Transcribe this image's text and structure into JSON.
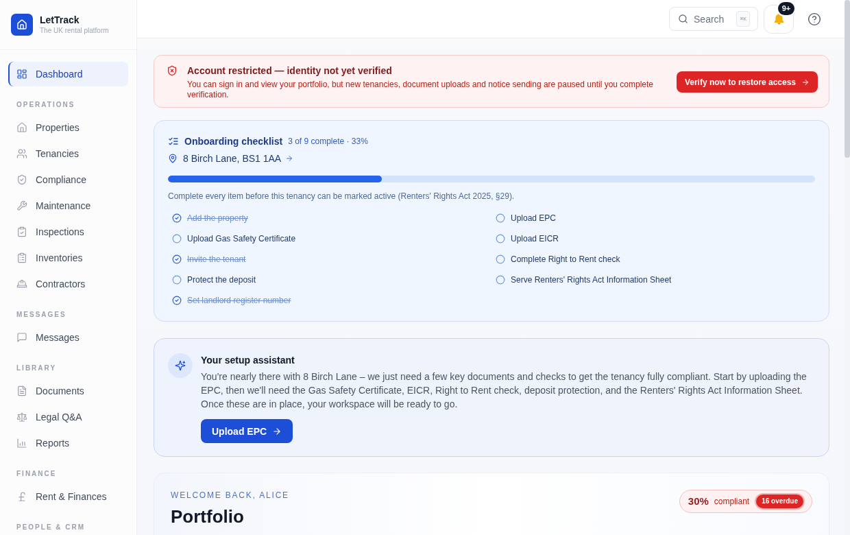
{
  "app": {
    "name": "LetTrack",
    "tagline": "The UK rental platform"
  },
  "sidebar": {
    "sections": [
      {
        "items": [
          {
            "label": "Dashboard",
            "selected": true
          }
        ]
      },
      {
        "heading": "OPERATIONS",
        "items": [
          {
            "label": "Properties",
            "selected": false
          },
          {
            "label": "Tenancies",
            "selected": false
          },
          {
            "label": "Compliance",
            "selected": false
          },
          {
            "label": "Maintenance",
            "selected": false
          },
          {
            "label": "Inspections",
            "selected": false
          },
          {
            "label": "Inventories",
            "selected": false
          },
          {
            "label": "Contractors",
            "selected": false
          }
        ]
      },
      {
        "heading": "MESSAGES",
        "items": [
          {
            "label": "Messages",
            "selected": false
          }
        ]
      },
      {
        "heading": "LIBRARY",
        "items": [
          {
            "label": "Documents",
            "selected": false
          },
          {
            "label": "Legal Q&A",
            "selected": false
          },
          {
            "label": "Reports",
            "selected": false
          }
        ]
      },
      {
        "heading": "FINANCE",
        "items": [
          {
            "label": "Rent & Finances",
            "selected": false
          }
        ]
      },
      {
        "heading": "PEOPLE & CRM"
      }
    ]
  },
  "topbar": {
    "search": {
      "label": "Search",
      "shortcut": "⌘K"
    },
    "notifications": {
      "count": "9+"
    }
  },
  "alert": {
    "title": "Account restricted — identity not yet verified",
    "message": "You can sign in and view your portfolio, but new tenancies, document uploads and notice sending are paused until you complete verification.",
    "action": "Verify now to restore access"
  },
  "checklist": {
    "title": "Onboarding checklist",
    "summary": "3 of 9 complete · 33%",
    "property": "8 Birch Lane, BS1 1AA",
    "progress": {
      "level": 0.33
    },
    "note": "Complete every item before this tenancy can be marked active (Renters' Rights Act 2025, §29).",
    "items": [
      {
        "label": "Add the property",
        "checked": true
      },
      {
        "label": "Upload EPC",
        "checked": false
      },
      {
        "label": "Upload Gas Safety Certificate",
        "checked": false
      },
      {
        "label": "Upload EICR",
        "checked": false
      },
      {
        "label": "Invite the tenant",
        "checked": true
      },
      {
        "label": "Complete Right to Rent check",
        "checked": false
      },
      {
        "label": "Protect the deposit",
        "checked": false
      },
      {
        "label": "Serve Renters' Rights Act Information Sheet",
        "checked": false
      },
      {
        "label": "Set landlord register number",
        "checked": true
      }
    ]
  },
  "assistant": {
    "title": "Your setup assistant",
    "message": "You're nearly there with 8 Birch Lane – we just need a few key documents and checks to get the tenancy fully compliant. Start by uploading the EPC, then we'll need the Gas Safety Certificate, EICR, Right to Rent check, deposit protection, and the Renters' Rights Act Information Sheet. Once these are in place, your workspace will be ready to go.",
    "action": "Upload EPC"
  },
  "portfolio": {
    "eyebrow": "WELCOME BACK, ALICE",
    "title": "Portfolio",
    "compliance": {
      "percent": "30%",
      "label": "compliant",
      "overdue": "16 overdue"
    }
  }
}
